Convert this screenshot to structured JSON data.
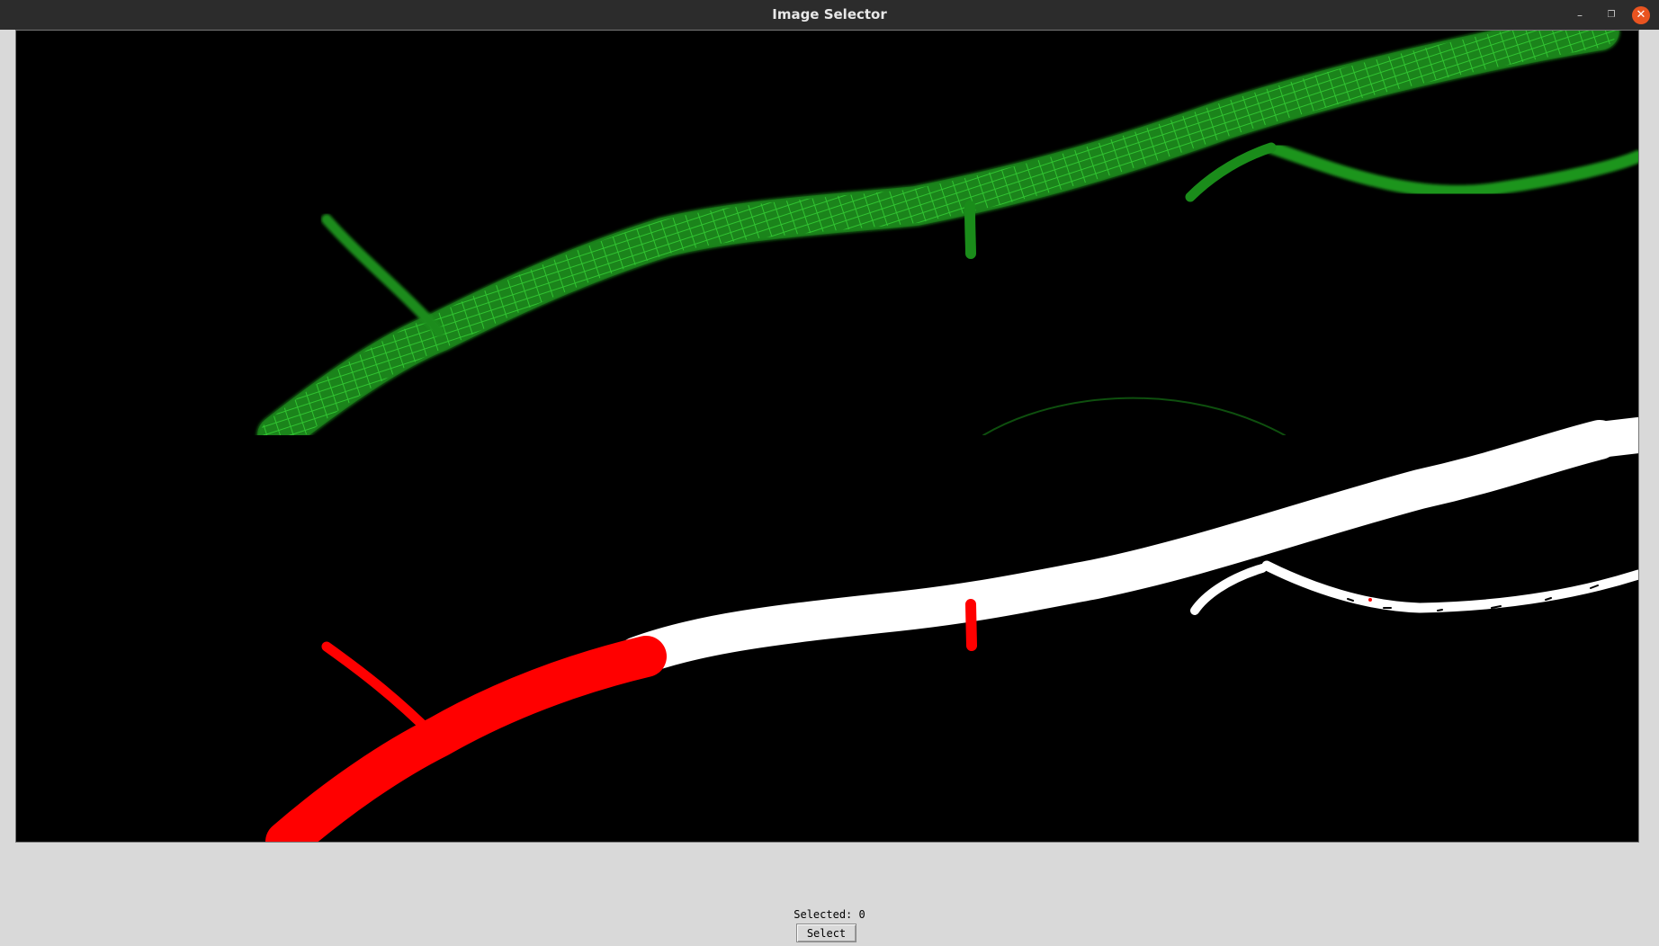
{
  "window": {
    "title": "Image Selector",
    "controls": {
      "minimize_icon": "–",
      "maximize_icon": "❐",
      "close_icon": "✕"
    }
  },
  "images": [
    {
      "name": "fluorescence-image",
      "colors": {
        "background": "#000000",
        "signal": "#22c922"
      }
    },
    {
      "name": "segmentation-mask",
      "colors": {
        "background": "#000000",
        "selected": "#ff0000",
        "unselected": "#ffffff"
      }
    }
  ],
  "status": {
    "selected_text": "Selected: 0"
  },
  "actions": {
    "select_label": "Select"
  }
}
